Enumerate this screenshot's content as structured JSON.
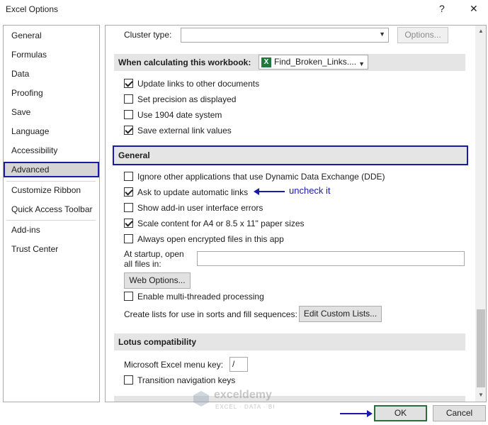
{
  "window": {
    "title": "Excel Options",
    "help_glyph": "?",
    "close_glyph": "✕"
  },
  "nav": {
    "items": [
      {
        "label": "General"
      },
      {
        "label": "Formulas"
      },
      {
        "label": "Data"
      },
      {
        "label": "Proofing"
      },
      {
        "label": "Save"
      },
      {
        "label": "Language"
      },
      {
        "label": "Accessibility"
      },
      {
        "label": "Advanced"
      },
      {
        "label": "Customize Ribbon"
      },
      {
        "label": "Quick Access Toolbar"
      },
      {
        "label": "Add-ins"
      },
      {
        "label": "Trust Center"
      }
    ],
    "selected": "Advanced"
  },
  "pane": {
    "cluster_type_label": "Cluster type:",
    "cluster_type_value": "",
    "options_button": "Options...",
    "calc_section": {
      "label": "When calculating this workbook:",
      "workbook_value": "Find_Broken_Links....",
      "options": [
        {
          "label": "Update links to other documents",
          "checked": true
        },
        {
          "label": "Set precision as displayed",
          "checked": false
        },
        {
          "label": "Use 1904 date system",
          "checked": false
        },
        {
          "label": "Save external link values",
          "checked": true
        }
      ]
    },
    "general_section": {
      "title": "General",
      "options": [
        {
          "label": "Ignore other applications that use Dynamic Data Exchange (DDE)",
          "checked": false
        },
        {
          "label": "Ask to update automatic links",
          "checked": true
        },
        {
          "label": "Show add-in user interface errors",
          "checked": false
        },
        {
          "label": "Scale content for A4 or 8.5 x 11\" paper sizes",
          "checked": true
        },
        {
          "label": "Always open encrypted files in this app",
          "checked": false
        }
      ],
      "startup_label_line1": "At startup, open",
      "startup_label_line2": "all files in:",
      "startup_value": "",
      "web_options_button": "Web Options...",
      "multithread_label": "Enable multi-threaded processing",
      "multithread_checked": false,
      "lists_label": "Create lists for use in sorts and fill sequences:",
      "edit_lists_button": "Edit Custom Lists..."
    },
    "lotus_section": {
      "title": "Lotus compatibility",
      "menu_key_label": "Microsoft Excel menu key:",
      "menu_key_value": "/",
      "transition_label": "Transition navigation keys",
      "transition_checked": false
    }
  },
  "annotation": {
    "text": "uncheck it",
    "color": "#1a1aa8"
  },
  "watermark": {
    "name": "exceldemy",
    "tagline": "EXCEL · DATA · BI"
  },
  "footer": {
    "ok": "OK",
    "cancel": "Cancel"
  },
  "colors": {
    "highlight_box": "#1a1aa8",
    "ok_border": "#2f6b3f",
    "excel_green": "#1d7a3c"
  }
}
